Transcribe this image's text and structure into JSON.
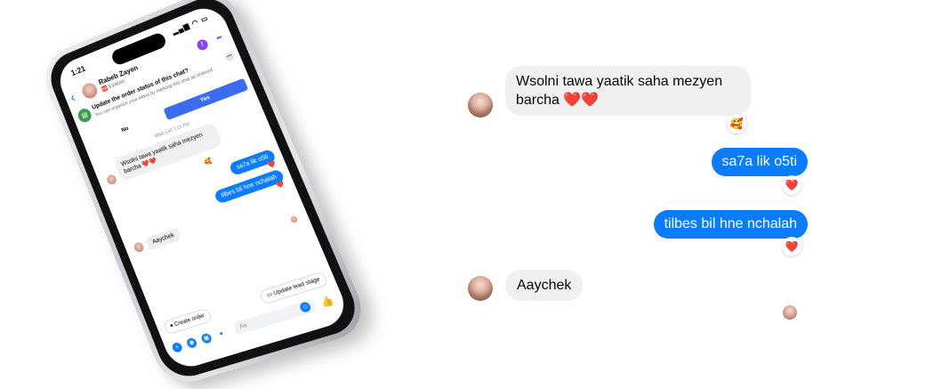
{
  "phone": {
    "status_time": "1:21",
    "status_icons": "▂▄▆ ◠ ▭",
    "contact_name": "Rabeb Zayen",
    "contact_sub": "🆎 Evaluer",
    "back_glyph": "‹",
    "banner": {
      "title": "Update the order status of this chat?",
      "body": "You can organize your inbox by marking this chat as ordered.",
      "no_label": "No",
      "yes_label": "Yes"
    },
    "date_label": "MAR 3 AT 1:21 PM",
    "messages": {
      "in1": "Wsolni tawa yaatik saha mezyen barcha ❤️❤️",
      "in1_reaction": "🥰",
      "out1": "sa7a lik o5ti",
      "out2": "tilbes bil hne nchalah",
      "out_reaction": "❤️",
      "in2": "Aaychek"
    },
    "actions": {
      "create_order": "Create order",
      "update_lead": "Update lead stage"
    },
    "compose": {
      "placeholder": "Aa",
      "like_glyph": "👍"
    }
  },
  "chat": {
    "incoming_1": "Wsolni tawa yaatik saha mezyen barcha ❤️❤️",
    "incoming_1_reaction": "🥰",
    "outgoing_1": "sa7a lik o5ti",
    "outgoing_1_reaction": "❤️",
    "outgoing_2": "tilbes bil hne nchalah",
    "outgoing_2_reaction": "❤️",
    "incoming_2": "Aaychek"
  },
  "colors": {
    "outgoing_bubble": "#0a7cff",
    "incoming_bubble": "#f0f0f0",
    "yes_button": "#3b6cf0"
  },
  "icons": [
    "back-chevron-icon",
    "facebook-icon",
    "more-icon",
    "order-icon",
    "close-icon",
    "plus-icon",
    "camera-icon",
    "gallery-icon",
    "mic-icon",
    "emoji-icon",
    "like-icon",
    "heart-icon"
  ]
}
